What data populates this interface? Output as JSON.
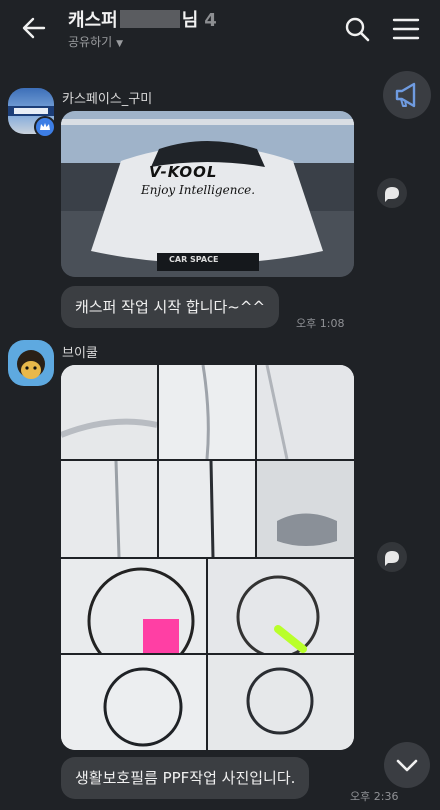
{
  "header": {
    "title_prefix": "캐스퍼",
    "title_suffix": "님",
    "member_count": "4",
    "share_label": "공유하기",
    "share_caret": "▼"
  },
  "messages": [
    {
      "sender": "카스페이스_구미",
      "photo_text": {
        "brand": "V-KOOL",
        "slogan": "Enjoy Intelligence.",
        "plate": "CAR SPACE"
      },
      "text": "캐스퍼 작업 시작 합니다~^^",
      "time": "오후 1:08"
    },
    {
      "sender": "브이쿨",
      "text": "생활보호필름 PPF작업 사진입니다.",
      "time": "오후 2:36"
    }
  ],
  "icons": {
    "back": "back-arrow-icon",
    "search": "search-icon",
    "menu": "hamburger-menu-icon",
    "notice": "megaphone-icon",
    "share": "forward-share-icon",
    "scroll": "chevron-down-icon"
  },
  "colors": {
    "background": "#1f2226",
    "bubble": "#3b3e42",
    "accent_blue": "#3d7ee5",
    "notice_icon": "#6f9be0"
  }
}
